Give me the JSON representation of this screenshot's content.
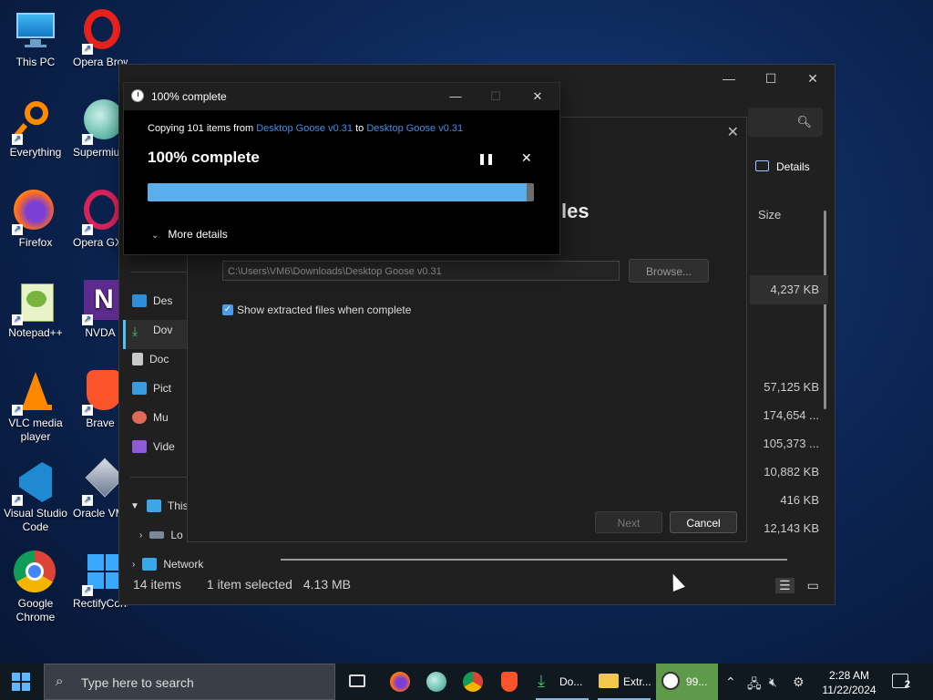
{
  "desktop": {
    "icons": [
      {
        "label": "This PC"
      },
      {
        "label": "Opera Browser"
      },
      {
        "label": "Everything"
      },
      {
        "label": "Supermium"
      },
      {
        "label": "Firefox"
      },
      {
        "label": "Opera GX Browser"
      },
      {
        "label": "Notepad++"
      },
      {
        "label": "NVDA"
      },
      {
        "label": "VLC media player"
      },
      {
        "label": "Brave"
      },
      {
        "label": "Visual Studio Code"
      },
      {
        "label": "Oracle VM VirtualBox"
      },
      {
        "label": "Google Chrome"
      },
      {
        "label": "RectifyContro..."
      }
    ]
  },
  "explorer": {
    "details_label": "Details",
    "size_header": "Size",
    "sizes": [
      "4,237 KB",
      "57,125 KB",
      "174,654 ...",
      "105,373 ...",
      "10,882 KB",
      "416 KB",
      "12,143 KB"
    ],
    "nav": [
      "Des",
      "Dov",
      "Doc",
      "Pict",
      "Mu",
      "Vide",
      "This",
      "Lo",
      "Network"
    ],
    "status": {
      "items": "14 items",
      "selected": "1 item selected",
      "size": "4.13 MB"
    }
  },
  "wizard": {
    "title_fragment": "les",
    "path_value": "C:\\Users\\VM6\\Downloads\\Desktop Goose v0.31",
    "browse_label": "Browse...",
    "checkbox_label": "Show extracted files when complete",
    "next_label": "Next",
    "cancel_label": "Cancel"
  },
  "copy_dialog": {
    "title": "100% complete",
    "copying_prefix": "Copying 101 items from",
    "source": "Desktop Goose v0.31",
    "to_word": "to",
    "dest": "Desktop Goose v0.31",
    "percent_text": "100% complete",
    "progress": 0.98,
    "more_details": "More details"
  },
  "taskbar": {
    "search_placeholder": "Type here to search",
    "app_labels": [
      "Do...",
      "Extr...",
      "99..."
    ],
    "time": "2:28 AM",
    "date": "11/22/2024",
    "notification_count": "2"
  },
  "colors": {
    "accent": "#4cc2ff",
    "link": "#3f8fe8",
    "progress": "#5aaeec"
  }
}
